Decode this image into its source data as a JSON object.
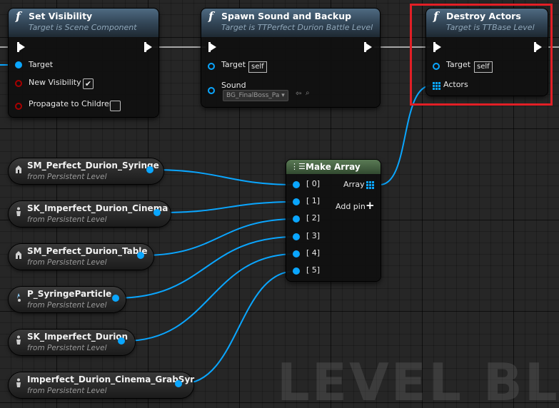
{
  "nodes": {
    "set_visibility": {
      "title": "Set Visibility",
      "subtitle": "Target is Scene Component",
      "pins": {
        "target": "Target",
        "new_visibility": "New Visibility",
        "propagate": "Propagate to Children"
      },
      "new_visibility_checked": "✔",
      "propagate_checked": ""
    },
    "spawn_sound": {
      "title": "Spawn Sound and Backup",
      "subtitle": "Target is TTPerfect Durion Battle Level",
      "pins": {
        "target": "Target",
        "sound": "Sound"
      },
      "target_value": "self",
      "sound_value": "BG_FinalBoss_Pa"
    },
    "destroy_actors": {
      "title": "Destroy Actors",
      "subtitle": "Target is TTBase Level",
      "pins": {
        "target": "Target",
        "actors": "Actors"
      },
      "target_value": "self"
    },
    "make_array": {
      "title": "Make Array",
      "inputs": [
        "[ 0]",
        "[ 1]",
        "[ 2]",
        "[ 3]",
        "[ 4]",
        "[ 5]"
      ],
      "output": "Array",
      "add_pin": "Add pin"
    }
  },
  "references": [
    {
      "name": "SM_Perfect_Durion_Syringe",
      "sub": "from Persistent Level"
    },
    {
      "name": "SK_Imperfect_Durion_Cinema",
      "sub": "from Persistent Level"
    },
    {
      "name": "SM_Perfect_Durion_Table",
      "sub": "from Persistent Level"
    },
    {
      "name": "P_SyringeParticle",
      "sub": "from Persistent Level"
    },
    {
      "name": "SK_Imperfect_Durion",
      "sub": "from Persistent Level"
    },
    {
      "name": "Imperfect_Durion_Cinema_GrabSyr",
      "sub": "from Persistent Level"
    }
  ],
  "watermark": "LEVEL BLUEPRINT",
  "colors": {
    "object_pin": "#0aa6ff",
    "bool_pin": "#a80000",
    "highlight": "#e21f26",
    "function_header": "#35495b",
    "make_array_header": "#324a30"
  }
}
